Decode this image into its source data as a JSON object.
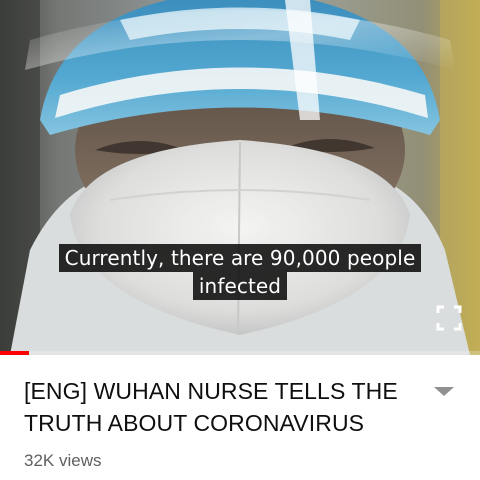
{
  "player": {
    "caption_lines": [
      "Currently, there are 90,000 people",
      "infected"
    ],
    "progress_fraction": 0.06,
    "progress_color": "#ff0000",
    "fullscreen_icon": "fullscreen-icon"
  },
  "video": {
    "title": "[ENG] WUHAN NURSE TELLS THE TRUTH ABOUT CORONAVIRUS",
    "views": "32K views",
    "expand_icon": "chevron-down-icon"
  }
}
